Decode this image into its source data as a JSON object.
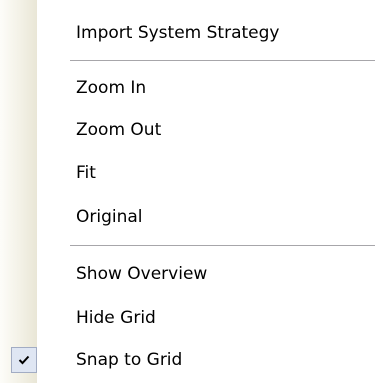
{
  "menu": {
    "items": [
      {
        "label": "Import System Strategy",
        "checked": false
      },
      {
        "label": "Zoom In",
        "checked": false
      },
      {
        "label": "Zoom Out",
        "checked": false
      },
      {
        "label": "Fit",
        "checked": false
      },
      {
        "label": "Original",
        "checked": false
      },
      {
        "label": "Show Overview",
        "checked": false
      },
      {
        "label": "Hide Grid",
        "checked": false
      },
      {
        "label": "Snap to Grid",
        "checked": true
      }
    ],
    "check_icon": "checkmark-icon"
  },
  "colors": {
    "gutter_light": "#fdfdf9",
    "gutter_dark": "#e9e6d6",
    "separator": "#a7a6aa",
    "check_bg": "#dfe6f3",
    "check_border": "#a2acc3",
    "text": "#000000"
  }
}
